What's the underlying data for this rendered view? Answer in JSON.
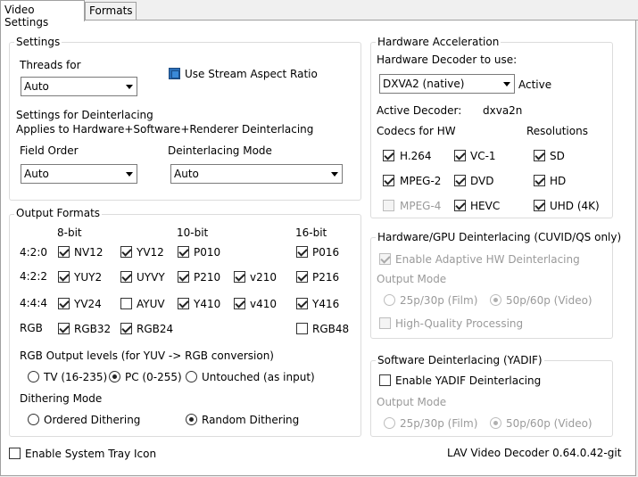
{
  "tabs": [
    "Video Settings",
    "Formats"
  ],
  "settings": {
    "title": "Settings",
    "threads_label": "Threads for",
    "threads_value": "Auto",
    "stream_aspect_label": "Use Stream Aspect Ratio",
    "deint_title": "Settings for Deinterlacing",
    "deint_sub": "Applies to Hardware+Software+Renderer Deinterlacing",
    "field_order_label": "Field Order",
    "field_order_value": "Auto",
    "deint_mode_label": "Deinterlacing Mode",
    "deint_mode_value": "Auto"
  },
  "output": {
    "title": "Output Formats",
    "col_8bit": "8-bit",
    "col_10bit": "10-bit",
    "col_16bit": "16-bit",
    "row_420": "4:2:0",
    "row_422": "4:2:2",
    "row_444": "4:4:4",
    "row_rgb": "RGB",
    "nv12": "NV12",
    "yv12": "YV12",
    "p010": "P010",
    "p016": "P016",
    "yuy2": "YUY2",
    "uyvy": "UYVY",
    "p210": "P210",
    "v210": "v210",
    "p216": "P216",
    "yv24": "YV24",
    "ayuv": "AYUV",
    "y410": "Y410",
    "v410": "v410",
    "y416": "Y416",
    "rgb32": "RGB32",
    "rgb24": "RGB24",
    "rgb48": "RGB48",
    "levels_label": "RGB Output levels (for YUV -> RGB conversion)",
    "tv": "TV (16-235)",
    "pc": "PC (0-255)",
    "untouched": "Untouched (as input)",
    "dither_label": "Dithering Mode",
    "ordered": "Ordered Dithering",
    "random": "Random Dithering"
  },
  "hw": {
    "title": "Hardware Acceleration",
    "decoder_label": "Hardware Decoder to use:",
    "decoder_value": "DXVA2 (native)",
    "status": "Active",
    "active_decoder_label": "Active Decoder:",
    "active_decoder_value": "dxva2n",
    "codecs_label": "Codecs for HW",
    "resolutions_label": "Resolutions",
    "h264": "H.264",
    "vc1": "VC-1",
    "mpeg2": "MPEG-2",
    "dvd": "DVD",
    "mpeg4": "MPEG-4",
    "hevc": "HEVC",
    "sd": "SD",
    "hd": "HD",
    "uhd": "UHD (4K)"
  },
  "gpu_deint": {
    "title": "Hardware/GPU Deinterlacing (CUVID/QS only)",
    "adaptive": "Enable Adaptive HW Deinterlacing",
    "output_mode": "Output Mode",
    "film": "25p/30p (Film)",
    "video": "50p/60p (Video)",
    "hq": "High-Quality Processing"
  },
  "sw_deint": {
    "title": "Software Deinterlacing (YADIF)",
    "enable": "Enable YADIF Deinterlacing",
    "output_mode": "Output Mode",
    "film": "25p/30p (Film)",
    "video": "50p/60p (Video)"
  },
  "footer": {
    "tray": "Enable System Tray Icon",
    "version": "LAV Video Decoder 0.64.0.42-git"
  }
}
